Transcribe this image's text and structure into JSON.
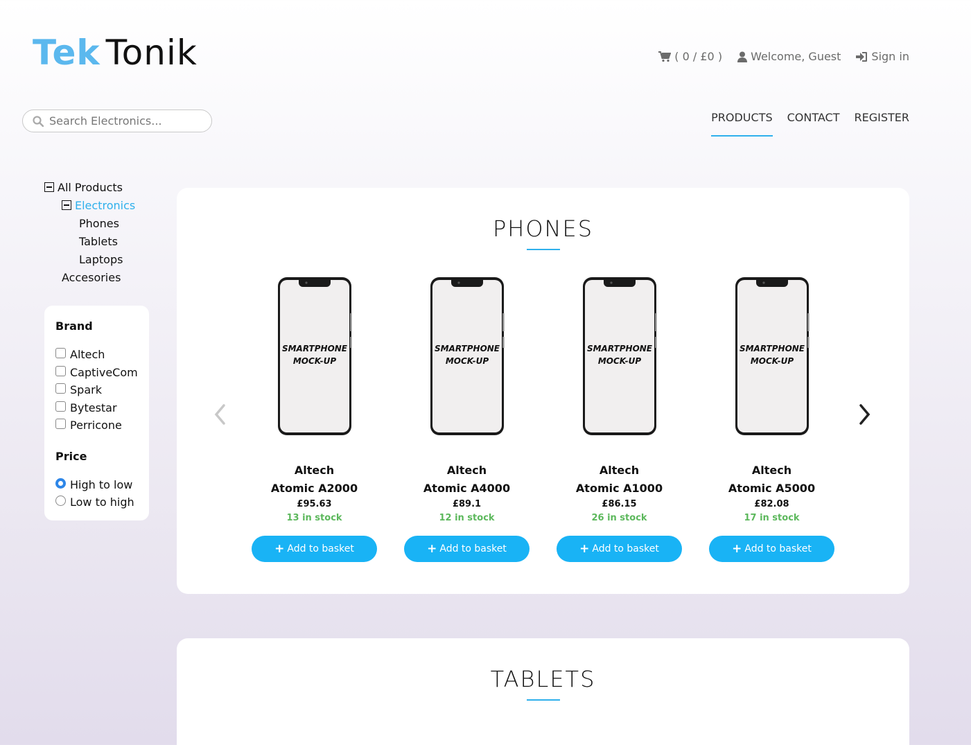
{
  "logo": {
    "part1": "Tek",
    "part2": "Tonik"
  },
  "header": {
    "cart": "( 0 / £0 )",
    "welcome": "Welcome, Guest",
    "signin": "Sign in"
  },
  "search": {
    "placeholder": "Search Electronics..."
  },
  "nav": [
    {
      "label": "PRODUCTS",
      "active": true
    },
    {
      "label": "CONTACT"
    },
    {
      "label": "REGISTER"
    }
  ],
  "tree": {
    "all": "All Products",
    "electronics": "Electronics",
    "phones": "Phones",
    "tablets": "Tablets",
    "laptops": "Laptops",
    "accessories": "Accesories"
  },
  "filters": {
    "brand_title": "Brand",
    "brands": [
      "Altech",
      "CaptiveCom",
      "Spark",
      "Bytestar",
      "Perricone"
    ],
    "price_title": "Price",
    "price_options": [
      "High to low",
      "Low to high"
    ],
    "price_selected": "High to low"
  },
  "sections": {
    "phones_title": "PHONES",
    "tablets_title": "TABLETS"
  },
  "products": [
    {
      "brand": "Altech",
      "model": "Atomic A2000",
      "price": "£95.63",
      "stock": "13 in stock"
    },
    {
      "brand": "Altech",
      "model": "Atomic A4000",
      "price": "£89.1",
      "stock": "12 in stock"
    },
    {
      "brand": "Altech",
      "model": "Atomic A1000",
      "price": "£86.15",
      "stock": "26 in stock"
    },
    {
      "brand": "Altech",
      "model": "Atomic A5000",
      "price": "£82.08",
      "stock": "17 in stock"
    }
  ],
  "phone_mock_text": [
    "SMARTPHONE",
    "MOCK-UP"
  ],
  "add_label": "Add to basket",
  "colors": {
    "accent": "#19b3f5",
    "stock": "#5cb85c",
    "logo_blue": "#5bb8ee"
  }
}
